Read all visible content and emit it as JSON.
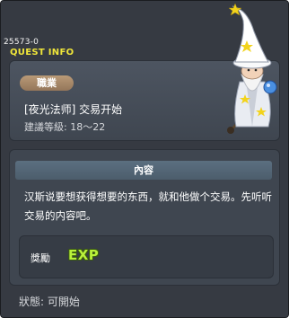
{
  "quest": {
    "id": "25573-0",
    "header_label": "QUEST INFO",
    "job_badge": "職業",
    "name": "[夜光法师] 交易开始",
    "level": "建議等級: 18～22"
  },
  "content": {
    "header": "內容",
    "text": "汉斯说要想获得想要的东西，就和他做个交易。先听听交易的内容吧。"
  },
  "reward": {
    "label": "獎勵",
    "exp_text": "EXP"
  },
  "status": {
    "text": "狀態: 可開始"
  },
  "npc": {
    "name_icon": "wizard-npc-icon",
    "colors": {
      "hat": "#ffffff",
      "star": "#f2d31c",
      "orb": "#4a8fe0"
    }
  }
}
